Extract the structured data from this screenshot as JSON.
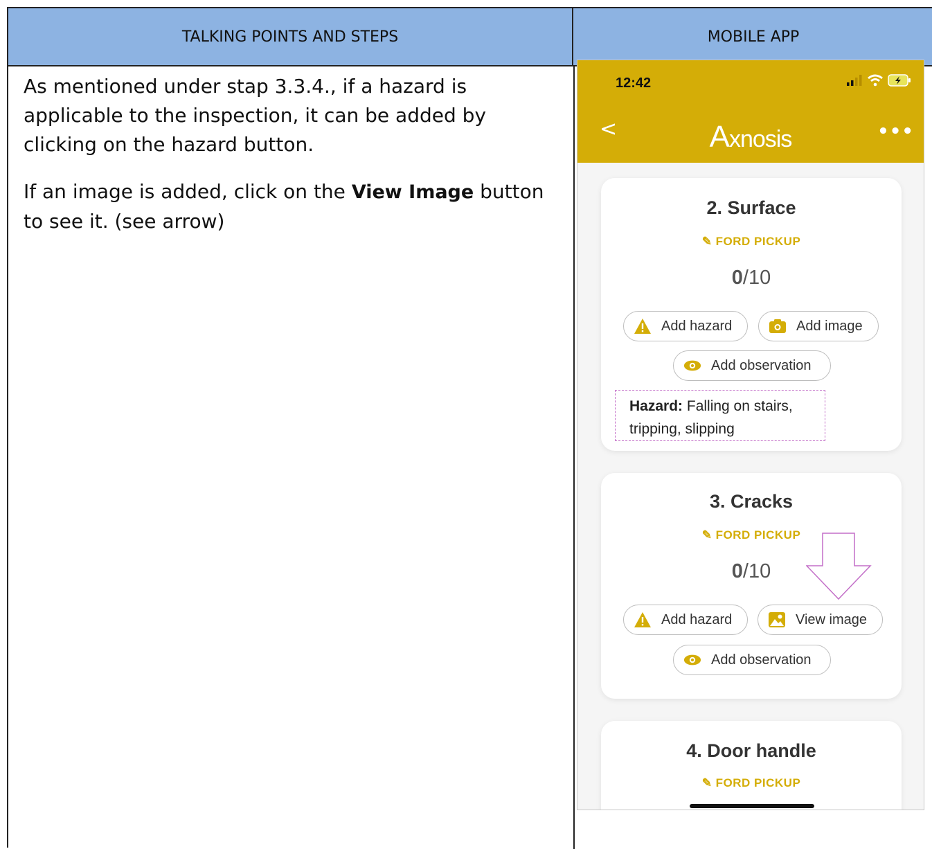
{
  "table": {
    "header_left": "TALKING POINTS AND STEPS",
    "header_right": "MOBILE APP"
  },
  "left": {
    "para1": "As mentioned under stap 3.3.4., if a hazard is applicable to the inspection, it can be added by clicking on the hazard button.",
    "para2_pre": "If an image is added, click on the ",
    "para2_bold": "View Image",
    "para2_post": " button to see it. (see arrow)"
  },
  "phone": {
    "time": "12:42",
    "brand": "xnosis",
    "brand_initial": "A",
    "back": "<",
    "more": "•••",
    "accent_color": "#d4ad07",
    "cards": [
      {
        "title": "2. Surface",
        "subtitle": "FORD PICKUP",
        "score_value": "0",
        "score_total": "/10",
        "buttons": [
          "Add hazard",
          "Add image",
          "Add observation"
        ],
        "hazard_label": "Hazard:",
        "hazard_text": " Falling on stairs, tripping, slipping"
      },
      {
        "title": "3. Cracks",
        "subtitle": "FORD PICKUP",
        "score_value": "0",
        "score_total": "/10",
        "buttons": [
          "Add hazard",
          "View image",
          "Add observation"
        ]
      },
      {
        "title": "4. Door handle",
        "subtitle": "FORD PICKUP"
      }
    ]
  }
}
